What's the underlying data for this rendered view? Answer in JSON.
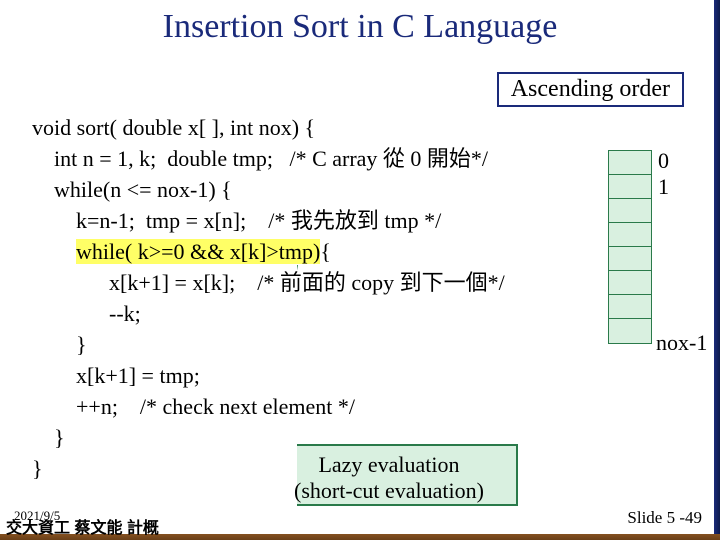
{
  "title": "Insertion Sort in C Language",
  "ascending": "Ascending order",
  "code": {
    "l1": "void sort( double x[ ], int nox) {",
    "l2": "    int n = 1, k;  double tmp;   /* C array 從 0 開始*/",
    "l3": "    while(n <= nox-1) {",
    "l4": "        k=n-1;  tmp = x[n];    /* 我先放到 tmp */",
    "l5a": "        ",
    "l5b": "while( k>=0 && x[k]>tmp)",
    "l5c": "{",
    "l6": "              x[k+1] = x[k];    /* 前面的 copy 到下一個*/",
    "l7": "              --k;",
    "l8": "        }",
    "l9": "        x[k+1] = tmp;",
    "l10": "        ++n;    /* check next element */",
    "l11": "    }",
    "l12": "}"
  },
  "array": {
    "idx0": "0",
    "idx1": "1",
    "idxn": "nox-1"
  },
  "callout": {
    "line1": "Lazy evaluation",
    "line2": "(short-cut evaluation)"
  },
  "date": "2021/9/5",
  "footer": "交大資工 蔡文能 計概",
  "slidenum": "Slide 5 -49"
}
